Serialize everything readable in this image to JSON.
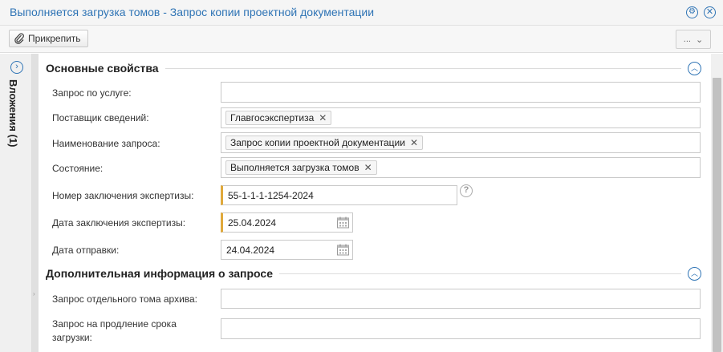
{
  "window": {
    "title": "Выполняется загрузка томов - Запрос копии проектной документации",
    "settings_icon": "settings-circle-icon",
    "close_icon": "close-circle-icon"
  },
  "toolbar": {
    "attach_label": "Прикрепить",
    "more_label": "..."
  },
  "sidetab": {
    "label": "Вложения (1)"
  },
  "sections": {
    "main": {
      "title": "Основные свойства"
    },
    "extra": {
      "title": "Дополнительная информация о запросе"
    }
  },
  "fields": {
    "service_request": {
      "label": "Запрос по услуге:",
      "value": ""
    },
    "supplier": {
      "label": "Поставщик сведений:",
      "tag": "Главгосэкспертиза"
    },
    "request_name": {
      "label": "Наименование запроса:",
      "tag": "Запрос копии проектной документации"
    },
    "state": {
      "label": "Состояние:",
      "tag": "Выполняется загрузка томов"
    },
    "conclusion_number": {
      "label": "Номер заключения экспертизы:",
      "value": "55-1-1-1-1254-2024"
    },
    "conclusion_date": {
      "label": "Дата заключения экспертизы:",
      "value": "25.04.2024"
    },
    "send_date": {
      "label": "Дата отправки:",
      "value": "24.04.2024"
    },
    "archive_volume": {
      "label": "Запрос отдельного тома архива:",
      "value": ""
    },
    "extend_load": {
      "label_line1": "Запрос на продление срока",
      "label_line2": "загрузки:",
      "value": ""
    }
  },
  "colors": {
    "accent": "#2f74b5",
    "required_marker": "#e0a93b"
  }
}
